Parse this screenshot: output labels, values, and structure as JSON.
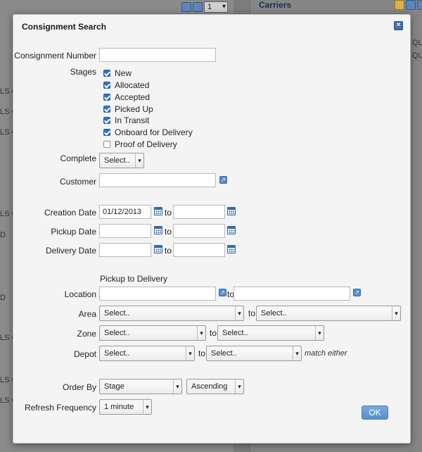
{
  "background": {
    "left_row_fragments": [
      "LS C",
      "LS C",
      "LS C",
      "LS C",
      "D",
      "D",
      "LS C",
      "LS C",
      "LS C"
    ],
    "page_number": "1",
    "carriers_heading": "Carriers",
    "right_fragments": [
      "QL",
      "QL"
    ]
  },
  "dialog": {
    "title": "Consignment Search",
    "close_icon": "close-icon",
    "consignment_number": {
      "label": "Consignment Number",
      "value": ""
    },
    "stages": {
      "label": "Stages",
      "items": [
        {
          "label": "New",
          "checked": true
        },
        {
          "label": "Allocated",
          "checked": true
        },
        {
          "label": "Accepted",
          "checked": true
        },
        {
          "label": "Picked Up",
          "checked": true
        },
        {
          "label": "In Transit",
          "checked": true
        },
        {
          "label": "Onboard for Delivery",
          "checked": true
        },
        {
          "label": "Proof of Delivery",
          "checked": false
        }
      ]
    },
    "complete": {
      "label": "Complete",
      "value": "Select.."
    },
    "customer": {
      "label": "Customer",
      "value": ""
    },
    "creation_date": {
      "label": "Creation Date",
      "from": "01/12/2013",
      "to_label": "to",
      "to": ""
    },
    "pickup_date": {
      "label": "Pickup Date",
      "from": "",
      "to_label": "to",
      "to": ""
    },
    "delivery_date": {
      "label": "Delivery Date",
      "from": "",
      "to_label": "to",
      "to": ""
    },
    "pickup_to_delivery_heading": "Pickup to Delivery",
    "location": {
      "label": "Location",
      "from": "",
      "to_label": "to",
      "to": ""
    },
    "area": {
      "label": "Area",
      "from": "Select..",
      "to_label": "to",
      "to": "Select.."
    },
    "zone": {
      "label": "Zone",
      "from": "Select..",
      "to_label": "to",
      "to": "Select.."
    },
    "depot": {
      "label": "Depot",
      "from": "Select..",
      "to_label": "to",
      "to": "Select..",
      "hint": "match either"
    },
    "order_by": {
      "label": "Order By",
      "field": "Stage",
      "direction": "Ascending"
    },
    "refresh_frequency": {
      "label": "Refresh Frequency",
      "value": "1 minute"
    },
    "ok_label": "OK"
  },
  "colors": {
    "accent": "#2f74c9",
    "button": "#5a8fcf",
    "title_text": "#1b2f52"
  }
}
